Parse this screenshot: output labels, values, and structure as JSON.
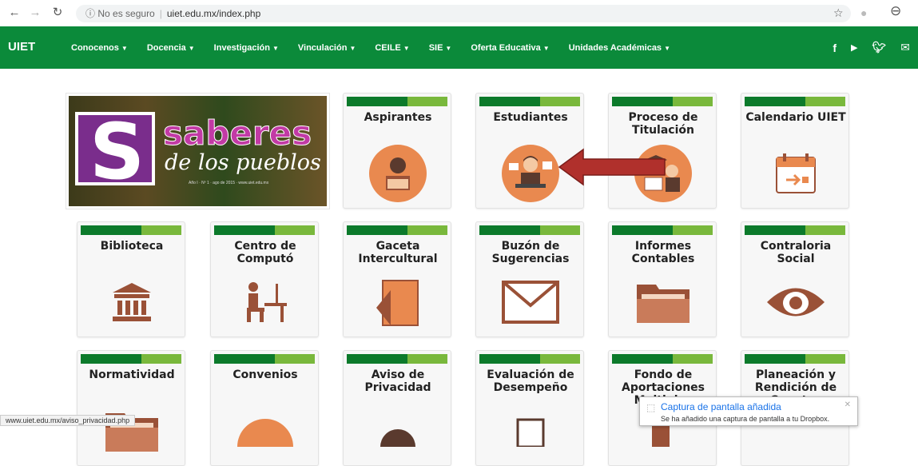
{
  "browser": {
    "back_icon": "arrow-left-icon",
    "forward_icon": "arrow-right-icon",
    "reload_icon": "reload-icon",
    "security_label": "No es seguro",
    "url": "uiet.edu.mx/index.php"
  },
  "navbar": {
    "brand": "UIET",
    "menu": [
      "Conocenos",
      "Docencia",
      "Investigación",
      "Vinculación",
      "CEILE",
      "SIE",
      "Oferta Educativa",
      "Unidades Académicas"
    ],
    "social": [
      "f",
      "You\nTube",
      "t",
      "✉"
    ],
    "color": "#0b8a3a"
  },
  "banner": {
    "s_letter": "S",
    "title": "saberes",
    "subtitle": "de los pueblos",
    "tagline": "Año I · Nº 1 · ago de 2015 · www.uiet.edu.mx"
  },
  "cards": [
    {
      "title": "Aspirantes",
      "icon": "student-reading-icon"
    },
    {
      "title": "Estudiantes",
      "icon": "student-laptop-icon"
    },
    {
      "title": "Proceso de Titulación",
      "icon": "graduation-icon"
    },
    {
      "title": "Calendario UIET",
      "icon": "calendar-icon"
    },
    {
      "title": "Biblioteca",
      "icon": "library-icon"
    },
    {
      "title": "Centro de Computó",
      "icon": "computer-desk-icon"
    },
    {
      "title": "Gaceta Intercultural",
      "icon": "book-icon"
    },
    {
      "title": "Buzón de Sugerencias",
      "icon": "envelope-icon"
    },
    {
      "title": "Informes Contables",
      "icon": "folder-icon"
    },
    {
      "title": "Contraloria Social",
      "icon": "eye-icon"
    },
    {
      "title": "Normatividad",
      "icon": "folder-icon"
    },
    {
      "title": "Convenios",
      "icon": "handshake-icon"
    },
    {
      "title": "Aviso de Privacidad",
      "icon": "lock-icon"
    },
    {
      "title": "Evaluación de Desempeño",
      "icon": "clipboard-icon"
    },
    {
      "title": "Fondo de Aportaciones Multiples",
      "icon": "document-icon"
    },
    {
      "title": "Planeación y Rendición de Cuentas",
      "icon": "chart-icon"
    }
  ],
  "status_bar": {
    "url": "www.uiet.edu.mx/aviso_privacidad.php"
  },
  "toast": {
    "title": "Captura de pantalla añadida",
    "body": "Se ha añadido una captura de pantalla a tu Dropbox."
  },
  "colors": {
    "stripe_dark": "#0c7a2b",
    "stripe_light": "#79b83c",
    "icon_orange": "#e9894f",
    "icon_brown": "#9a5137",
    "arrow": "#b0302c"
  }
}
